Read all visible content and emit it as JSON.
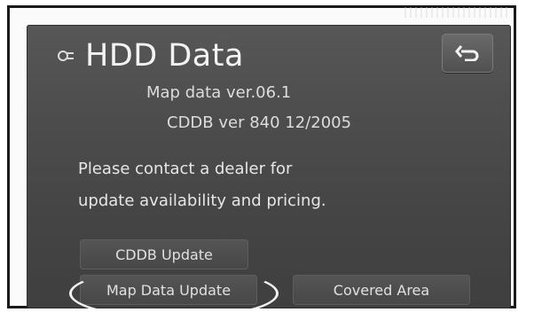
{
  "window": {
    "title": "HDD Data",
    "title_icon": "hdd-icon",
    "back_icon": "return-arrow-icon"
  },
  "info": {
    "map_data_version": "Map data ver.06.1",
    "cddb_version": "CDDB ver 840 12/2005"
  },
  "message": {
    "line1": "Please contact a dealer for",
    "line2": "update availability and pricing."
  },
  "buttons": {
    "cddb_update": "CDDB Update",
    "map_data_update": "Map Data Update",
    "covered_area": "Covered Area"
  },
  "colors": {
    "screen_bg": "#4c4c4c",
    "text": "#f3f3f3",
    "button_bg": "#4f4f4f"
  }
}
